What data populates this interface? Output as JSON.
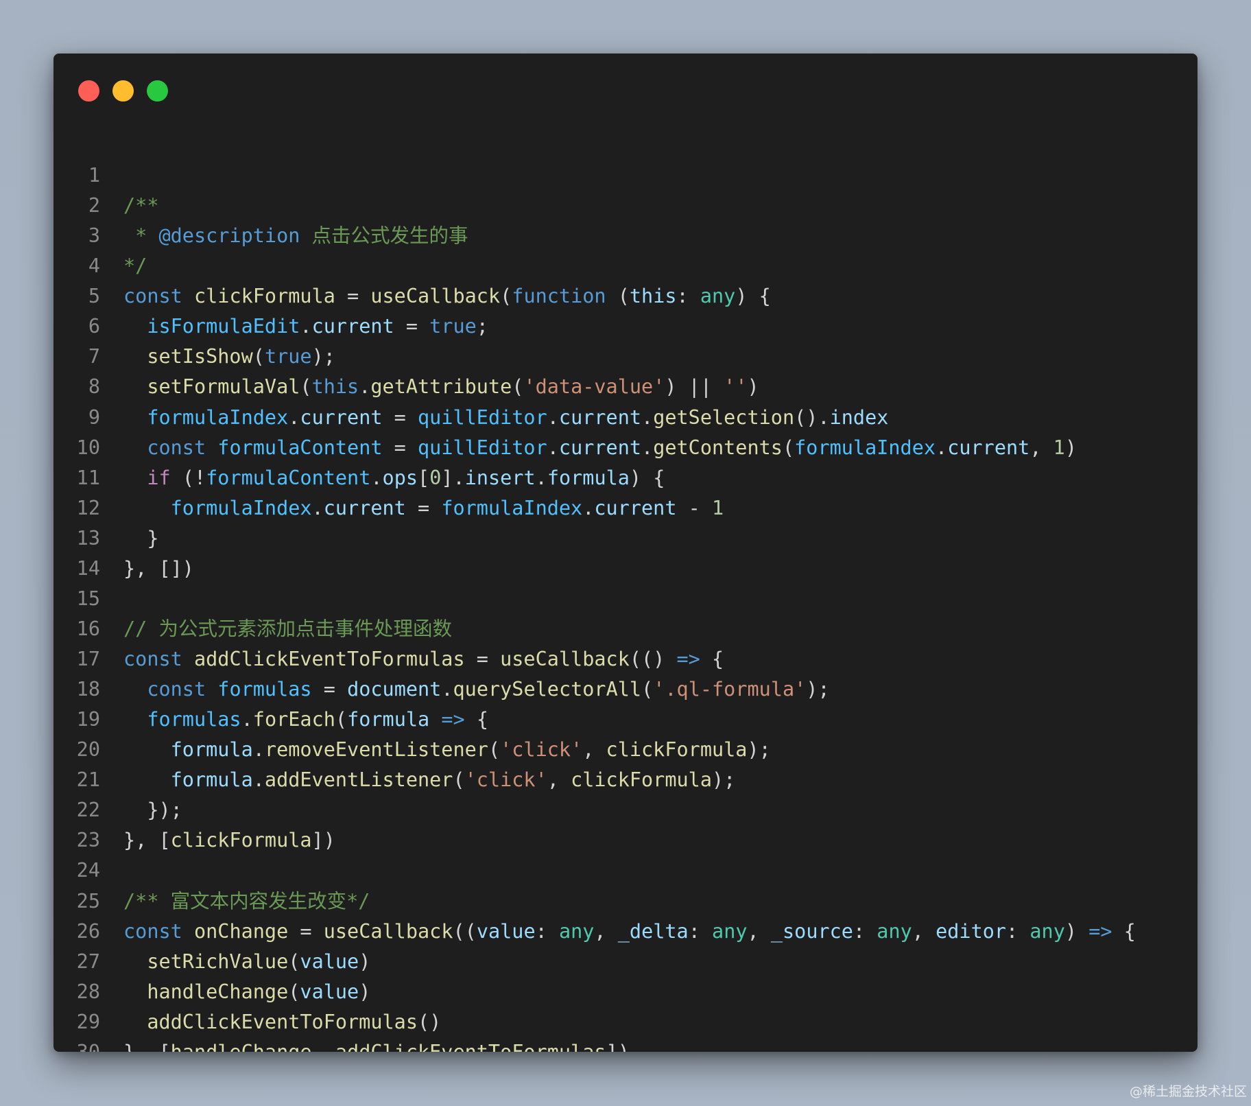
{
  "window": {
    "buttons": [
      {
        "name": "close",
        "color": "#ff5f57"
      },
      {
        "name": "minimize",
        "color": "#febc2e"
      },
      {
        "name": "maximize",
        "color": "#28c840"
      }
    ]
  },
  "lines": [
    {
      "n": "1",
      "tokens": []
    },
    {
      "n": "2",
      "tokens": [
        {
          "t": "com",
          "v": "/**"
        }
      ]
    },
    {
      "n": "3",
      "tokens": [
        {
          "t": "com",
          "v": " * "
        },
        {
          "t": "kw",
          "v": "@description"
        },
        {
          "t": "com",
          "v": " 点击公式发生的事"
        }
      ]
    },
    {
      "n": "4",
      "tokens": [
        {
          "t": "com",
          "v": "*/"
        }
      ]
    },
    {
      "n": "5",
      "tokens": [
        {
          "t": "kw",
          "v": "const"
        },
        {
          "t": "plain",
          "v": " "
        },
        {
          "t": "fn",
          "v": "clickFormula"
        },
        {
          "t": "plain",
          "v": " = "
        },
        {
          "t": "fn",
          "v": "useCallback"
        },
        {
          "t": "plain",
          "v": "("
        },
        {
          "t": "kw",
          "v": "function"
        },
        {
          "t": "plain",
          "v": " ("
        },
        {
          "t": "var",
          "v": "this"
        },
        {
          "t": "plain",
          "v": ": "
        },
        {
          "t": "type",
          "v": "any"
        },
        {
          "t": "plain",
          "v": ") {"
        }
      ]
    },
    {
      "n": "6",
      "tokens": [
        {
          "t": "plain",
          "v": "  "
        },
        {
          "t": "cvar",
          "v": "isFormulaEdit"
        },
        {
          "t": "plain",
          "v": "."
        },
        {
          "t": "var",
          "v": "current"
        },
        {
          "t": "plain",
          "v": " = "
        },
        {
          "t": "kw",
          "v": "true"
        },
        {
          "t": "plain",
          "v": ";"
        }
      ]
    },
    {
      "n": "7",
      "tokens": [
        {
          "t": "plain",
          "v": "  "
        },
        {
          "t": "fn",
          "v": "setIsShow"
        },
        {
          "t": "plain",
          "v": "("
        },
        {
          "t": "kw",
          "v": "true"
        },
        {
          "t": "plain",
          "v": ");"
        }
      ]
    },
    {
      "n": "8",
      "tokens": [
        {
          "t": "plain",
          "v": "  "
        },
        {
          "t": "fn",
          "v": "setFormulaVal"
        },
        {
          "t": "plain",
          "v": "("
        },
        {
          "t": "kw",
          "v": "this"
        },
        {
          "t": "plain",
          "v": "."
        },
        {
          "t": "fn",
          "v": "getAttribute"
        },
        {
          "t": "plain",
          "v": "("
        },
        {
          "t": "str",
          "v": "'data-value'"
        },
        {
          "t": "plain",
          "v": ") || "
        },
        {
          "t": "str",
          "v": "''"
        },
        {
          "t": "plain",
          "v": ")"
        }
      ]
    },
    {
      "n": "9",
      "tokens": [
        {
          "t": "plain",
          "v": "  "
        },
        {
          "t": "cvar",
          "v": "formulaIndex"
        },
        {
          "t": "plain",
          "v": "."
        },
        {
          "t": "var",
          "v": "current"
        },
        {
          "t": "plain",
          "v": " = "
        },
        {
          "t": "cvar",
          "v": "quillEditor"
        },
        {
          "t": "plain",
          "v": "."
        },
        {
          "t": "var",
          "v": "current"
        },
        {
          "t": "plain",
          "v": "."
        },
        {
          "t": "fn",
          "v": "getSelection"
        },
        {
          "t": "plain",
          "v": "()."
        },
        {
          "t": "var",
          "v": "index"
        }
      ]
    },
    {
      "n": "10",
      "tokens": [
        {
          "t": "plain",
          "v": "  "
        },
        {
          "t": "kw",
          "v": "const"
        },
        {
          "t": "plain",
          "v": " "
        },
        {
          "t": "cvar",
          "v": "formulaContent"
        },
        {
          "t": "plain",
          "v": " = "
        },
        {
          "t": "cvar",
          "v": "quillEditor"
        },
        {
          "t": "plain",
          "v": "."
        },
        {
          "t": "var",
          "v": "current"
        },
        {
          "t": "plain",
          "v": "."
        },
        {
          "t": "fn",
          "v": "getContents"
        },
        {
          "t": "plain",
          "v": "("
        },
        {
          "t": "cvar",
          "v": "formulaIndex"
        },
        {
          "t": "plain",
          "v": "."
        },
        {
          "t": "var",
          "v": "current"
        },
        {
          "t": "plain",
          "v": ", "
        },
        {
          "t": "num",
          "v": "1"
        },
        {
          "t": "plain",
          "v": ")"
        }
      ]
    },
    {
      "n": "11",
      "tokens": [
        {
          "t": "plain",
          "v": "  "
        },
        {
          "t": "ctl",
          "v": "if"
        },
        {
          "t": "plain",
          "v": " (!"
        },
        {
          "t": "cvar",
          "v": "formulaContent"
        },
        {
          "t": "plain",
          "v": "."
        },
        {
          "t": "var",
          "v": "ops"
        },
        {
          "t": "plain",
          "v": "["
        },
        {
          "t": "num",
          "v": "0"
        },
        {
          "t": "plain",
          "v": "]."
        },
        {
          "t": "var",
          "v": "insert"
        },
        {
          "t": "plain",
          "v": "."
        },
        {
          "t": "var",
          "v": "formula"
        },
        {
          "t": "plain",
          "v": ") {"
        }
      ]
    },
    {
      "n": "12",
      "tokens": [
        {
          "t": "plain",
          "v": "    "
        },
        {
          "t": "cvar",
          "v": "formulaIndex"
        },
        {
          "t": "plain",
          "v": "."
        },
        {
          "t": "var",
          "v": "current"
        },
        {
          "t": "plain",
          "v": " = "
        },
        {
          "t": "cvar",
          "v": "formulaIndex"
        },
        {
          "t": "plain",
          "v": "."
        },
        {
          "t": "var",
          "v": "current"
        },
        {
          "t": "plain",
          "v": " - "
        },
        {
          "t": "num",
          "v": "1"
        }
      ]
    },
    {
      "n": "13",
      "tokens": [
        {
          "t": "plain",
          "v": "  }"
        }
      ]
    },
    {
      "n": "14",
      "tokens": [
        {
          "t": "plain",
          "v": "}, [])"
        }
      ]
    },
    {
      "n": "15",
      "tokens": []
    },
    {
      "n": "16",
      "tokens": [
        {
          "t": "com",
          "v": "// 为公式元素添加点击事件处理函数"
        }
      ]
    },
    {
      "n": "17",
      "tokens": [
        {
          "t": "kw",
          "v": "const"
        },
        {
          "t": "plain",
          "v": " "
        },
        {
          "t": "fn",
          "v": "addClickEventToFormulas"
        },
        {
          "t": "plain",
          "v": " = "
        },
        {
          "t": "fn",
          "v": "useCallback"
        },
        {
          "t": "plain",
          "v": "(() "
        },
        {
          "t": "kw",
          "v": "=>"
        },
        {
          "t": "plain",
          "v": " {"
        }
      ]
    },
    {
      "n": "18",
      "tokens": [
        {
          "t": "plain",
          "v": "  "
        },
        {
          "t": "kw",
          "v": "const"
        },
        {
          "t": "plain",
          "v": " "
        },
        {
          "t": "cvar",
          "v": "formulas"
        },
        {
          "t": "plain",
          "v": " = "
        },
        {
          "t": "var",
          "v": "document"
        },
        {
          "t": "plain",
          "v": "."
        },
        {
          "t": "fn",
          "v": "querySelectorAll"
        },
        {
          "t": "plain",
          "v": "("
        },
        {
          "t": "str",
          "v": "'.ql-formula'"
        },
        {
          "t": "plain",
          "v": ");"
        }
      ]
    },
    {
      "n": "19",
      "tokens": [
        {
          "t": "plain",
          "v": "  "
        },
        {
          "t": "cvar",
          "v": "formulas"
        },
        {
          "t": "plain",
          "v": "."
        },
        {
          "t": "fn",
          "v": "forEach"
        },
        {
          "t": "plain",
          "v": "("
        },
        {
          "t": "var",
          "v": "formula"
        },
        {
          "t": "plain",
          "v": " "
        },
        {
          "t": "kw",
          "v": "=>"
        },
        {
          "t": "plain",
          "v": " {"
        }
      ]
    },
    {
      "n": "20",
      "tokens": [
        {
          "t": "plain",
          "v": "    "
        },
        {
          "t": "var",
          "v": "formula"
        },
        {
          "t": "plain",
          "v": "."
        },
        {
          "t": "fn",
          "v": "removeEventListener"
        },
        {
          "t": "plain",
          "v": "("
        },
        {
          "t": "str",
          "v": "'click'"
        },
        {
          "t": "plain",
          "v": ", "
        },
        {
          "t": "fn",
          "v": "clickFormula"
        },
        {
          "t": "plain",
          "v": ");"
        }
      ]
    },
    {
      "n": "21",
      "tokens": [
        {
          "t": "plain",
          "v": "    "
        },
        {
          "t": "var",
          "v": "formula"
        },
        {
          "t": "plain",
          "v": "."
        },
        {
          "t": "fn",
          "v": "addEventListener"
        },
        {
          "t": "plain",
          "v": "("
        },
        {
          "t": "str",
          "v": "'click'"
        },
        {
          "t": "plain",
          "v": ", "
        },
        {
          "t": "fn",
          "v": "clickFormula"
        },
        {
          "t": "plain",
          "v": ");"
        }
      ]
    },
    {
      "n": "22",
      "tokens": [
        {
          "t": "plain",
          "v": "  });"
        }
      ]
    },
    {
      "n": "23",
      "tokens": [
        {
          "t": "plain",
          "v": "}, ["
        },
        {
          "t": "fn",
          "v": "clickFormula"
        },
        {
          "t": "plain",
          "v": "])"
        }
      ]
    },
    {
      "n": "24",
      "tokens": []
    },
    {
      "n": "25",
      "tokens": [
        {
          "t": "com",
          "v": "/** 富文本内容发生改变*/"
        }
      ]
    },
    {
      "n": "26",
      "tokens": [
        {
          "t": "kw",
          "v": "const"
        },
        {
          "t": "plain",
          "v": " "
        },
        {
          "t": "fn",
          "v": "onChange"
        },
        {
          "t": "plain",
          "v": " = "
        },
        {
          "t": "fn",
          "v": "useCallback"
        },
        {
          "t": "plain",
          "v": "(("
        },
        {
          "t": "var",
          "v": "value"
        },
        {
          "t": "plain",
          "v": ": "
        },
        {
          "t": "type",
          "v": "any"
        },
        {
          "t": "plain",
          "v": ", "
        },
        {
          "t": "var",
          "v": "_delta"
        },
        {
          "t": "plain",
          "v": ": "
        },
        {
          "t": "type",
          "v": "any"
        },
        {
          "t": "plain",
          "v": ", "
        },
        {
          "t": "var",
          "v": "_source"
        },
        {
          "t": "plain",
          "v": ": "
        },
        {
          "t": "type",
          "v": "any"
        },
        {
          "t": "plain",
          "v": ", "
        },
        {
          "t": "var",
          "v": "editor"
        },
        {
          "t": "plain",
          "v": ": "
        },
        {
          "t": "type",
          "v": "any"
        },
        {
          "t": "plain",
          "v": ") "
        },
        {
          "t": "kw",
          "v": "=>"
        },
        {
          "t": "plain",
          "v": " {"
        }
      ]
    },
    {
      "n": "27",
      "tokens": [
        {
          "t": "plain",
          "v": "  "
        },
        {
          "t": "fn",
          "v": "setRichValue"
        },
        {
          "t": "plain",
          "v": "("
        },
        {
          "t": "var",
          "v": "value"
        },
        {
          "t": "plain",
          "v": ")"
        }
      ]
    },
    {
      "n": "28",
      "tokens": [
        {
          "t": "plain",
          "v": "  "
        },
        {
          "t": "fn",
          "v": "handleChange"
        },
        {
          "t": "plain",
          "v": "("
        },
        {
          "t": "var",
          "v": "value"
        },
        {
          "t": "plain",
          "v": ")"
        }
      ]
    },
    {
      "n": "29",
      "tokens": [
        {
          "t": "plain",
          "v": "  "
        },
        {
          "t": "fn",
          "v": "addClickEventToFormulas"
        },
        {
          "t": "plain",
          "v": "()"
        }
      ]
    },
    {
      "n": "30",
      "tokens": [
        {
          "t": "plain",
          "v": "}, ["
        },
        {
          "t": "fn",
          "v": "handleChange"
        },
        {
          "t": "plain",
          "v": ", "
        },
        {
          "t": "fn",
          "v": "addClickEventToFormulas"
        },
        {
          "t": "plain",
          "v": "])"
        }
      ]
    }
  ],
  "watermark": "@稀土掘金技术社区"
}
